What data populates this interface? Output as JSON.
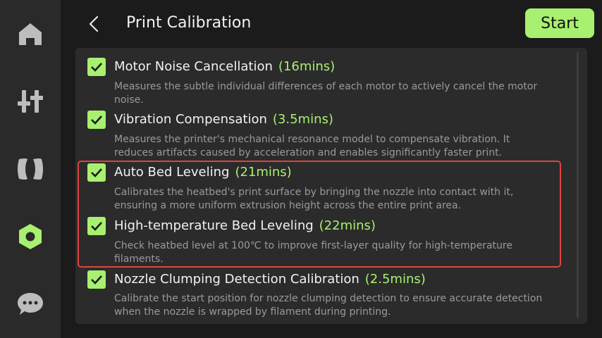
{
  "header": {
    "title": "Print Calibration",
    "start_label": "Start"
  },
  "sidebar": {
    "items": [
      {
        "icon": "home-icon"
      },
      {
        "icon": "adjust-sliders-icon"
      },
      {
        "icon": "filament-spool-icon"
      },
      {
        "icon": "hex-nut-settings-icon",
        "active": true
      },
      {
        "icon": "chat-bubble-icon"
      }
    ]
  },
  "calibration": {
    "items": [
      {
        "title": "Motor Noise Cancellation",
        "time": "(16mins)",
        "desc": "Measures the subtle individual differences of each motor to actively cancel the motor noise.",
        "checked": true
      },
      {
        "title": "Vibration Compensation",
        "time": "(3.5mins)",
        "desc": "Measures the printer's mechanical resonance model to compensate vibration. It reduces artifacts caused by acceleration and enables significantly faster print.",
        "checked": true
      },
      {
        "title": "Auto Bed Leveling",
        "time": "(21mins)",
        "desc": "Calibrates the heatbed's print surface by bringing the nozzle into contact with it, ensuring a more uniform extrusion height across the entire print area.",
        "checked": true
      },
      {
        "title": "High-temperature Bed Leveling",
        "time": "(22mins)",
        "desc": "Check heatbed level at 100℃ to improve first-layer quality for high-temperature filaments.",
        "checked": true
      },
      {
        "title": "Nozzle Clumping Detection Calibration",
        "time": "(2.5mins)",
        "desc": "Calibrate the start position for nozzle clumping detection to ensure accurate detection when the nozzle is wrapped by filament during printing.",
        "checked": true
      }
    ]
  },
  "colors": {
    "accent": "#a8f070",
    "highlight_border": "#e0433f",
    "background": "#1b1b1b",
    "panel": "#2b2b2b",
    "sidebar": "#2a2a2a"
  }
}
